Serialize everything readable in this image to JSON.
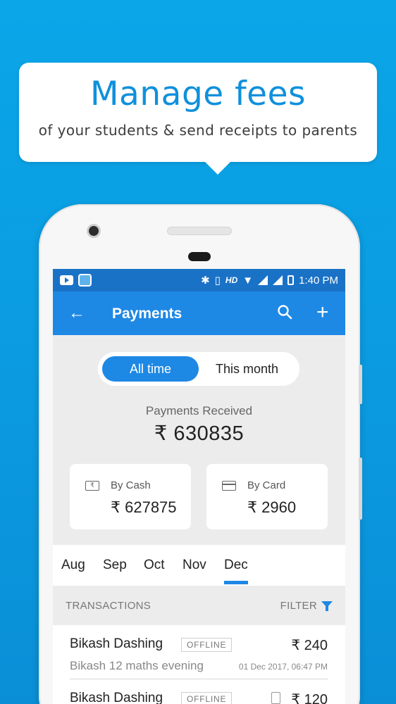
{
  "banner": {
    "headline": "Manage fees",
    "subline": "of your students & send receipts to parents"
  },
  "status_bar": {
    "time": "1:40 PM",
    "hd": "HD"
  },
  "app_bar": {
    "title": "Payments",
    "back_icon": "arrow-back-icon",
    "search_icon": "search-icon",
    "add_icon": "plus-icon"
  },
  "period_toggle": {
    "options": [
      "All time",
      "This month"
    ],
    "selected": "All time"
  },
  "summary": {
    "label": "Payments Received",
    "amount": "₹ 630835",
    "cards": [
      {
        "label": "By Cash",
        "amount": "₹ 627875",
        "icon": "rupee-note-icon"
      },
      {
        "label": "By Card",
        "amount": "₹ 2960",
        "icon": "credit-card-icon"
      }
    ]
  },
  "months": {
    "items": [
      "Aug",
      "Sep",
      "Oct",
      "Nov",
      "Dec"
    ],
    "selected": "Dec"
  },
  "transactions": {
    "header": "TRANSACTIONS",
    "filter_label": "FILTER",
    "rows": [
      {
        "name": "Bikash Dashing",
        "badge": "OFFLINE",
        "amount": "₹ 240",
        "description": "Bikash 12 maths evening",
        "date": "01 Dec 2017, 06:47 PM"
      },
      {
        "name": "Bikash Dashing",
        "badge": "OFFLINE",
        "amount": "₹ 120"
      }
    ]
  },
  "colors": {
    "background": "#0aa6e8",
    "primary": "#1e88e5",
    "status_bar": "#1a72c6",
    "headline": "#0f90dc"
  }
}
